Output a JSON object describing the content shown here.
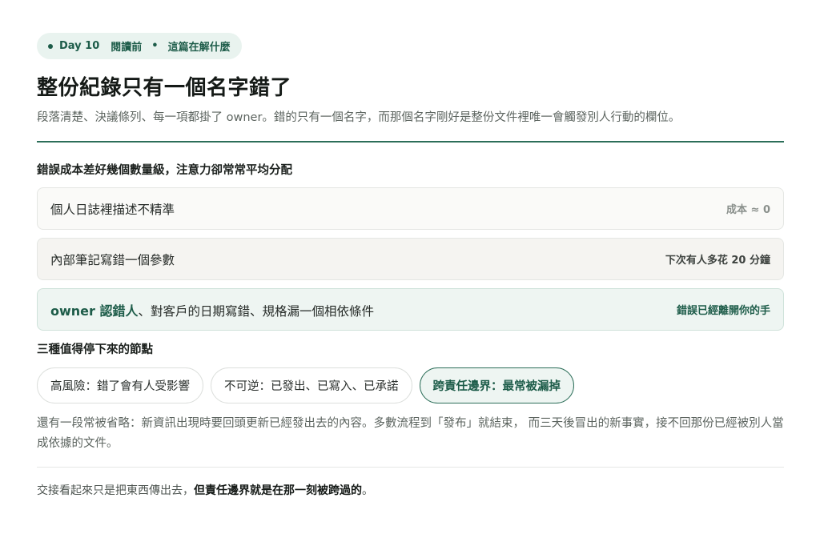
{
  "header": {
    "day": "Day 10",
    "stage": "閱讀前",
    "separator": "•",
    "topic": "這篇在解什麼"
  },
  "title": "整份紀錄只有一個名字錯了",
  "subtitle": "段落清楚、決議條列、每一項都掛了 owner。錯的只有一個名字，而那個名字剛好是整份文件裡唯一會觸發別人行動的欄位。",
  "cost_section": {
    "title": "錯誤成本差好幾個數量級，注意力卻常常平均分配",
    "rows": [
      {
        "label": "個人日誌裡描述不精準",
        "note": "成本 ≈ 0"
      },
      {
        "label": "內部筆記寫錯一個參數",
        "note": "下次有人多花 20 分鐘"
      },
      {
        "strong": "owner 認錯人",
        "label": "、對客戶的日期寫錯、規格漏一個相依條件",
        "note": "錯誤已經離開你的手"
      }
    ]
  },
  "nodes_section": {
    "title": "三種值得停下來的節點",
    "chips": [
      {
        "label": "高風險：錯了會有人受影響"
      },
      {
        "label": "不可逆：已發出、已寫入、已承諾"
      },
      {
        "label": "跨責任邊界：最常被漏掉"
      }
    ]
  },
  "paragraph": "還有一段常被省略：新資訊出現時要回頭更新已經發出去的內容。多數流程到「發布」就結束， 而三天後冒出的新事實，接不回那份已經被別人當成依據的文件。",
  "footer": {
    "lead": "交接看起來只是把東西傳出去，",
    "bold": "但責任邊界就是在那一刻被跨過的",
    "tail": "。"
  },
  "colors": {
    "accent": "#1d5c49",
    "accent_light": "#eef5f2",
    "rule": "#2c6e59"
  }
}
